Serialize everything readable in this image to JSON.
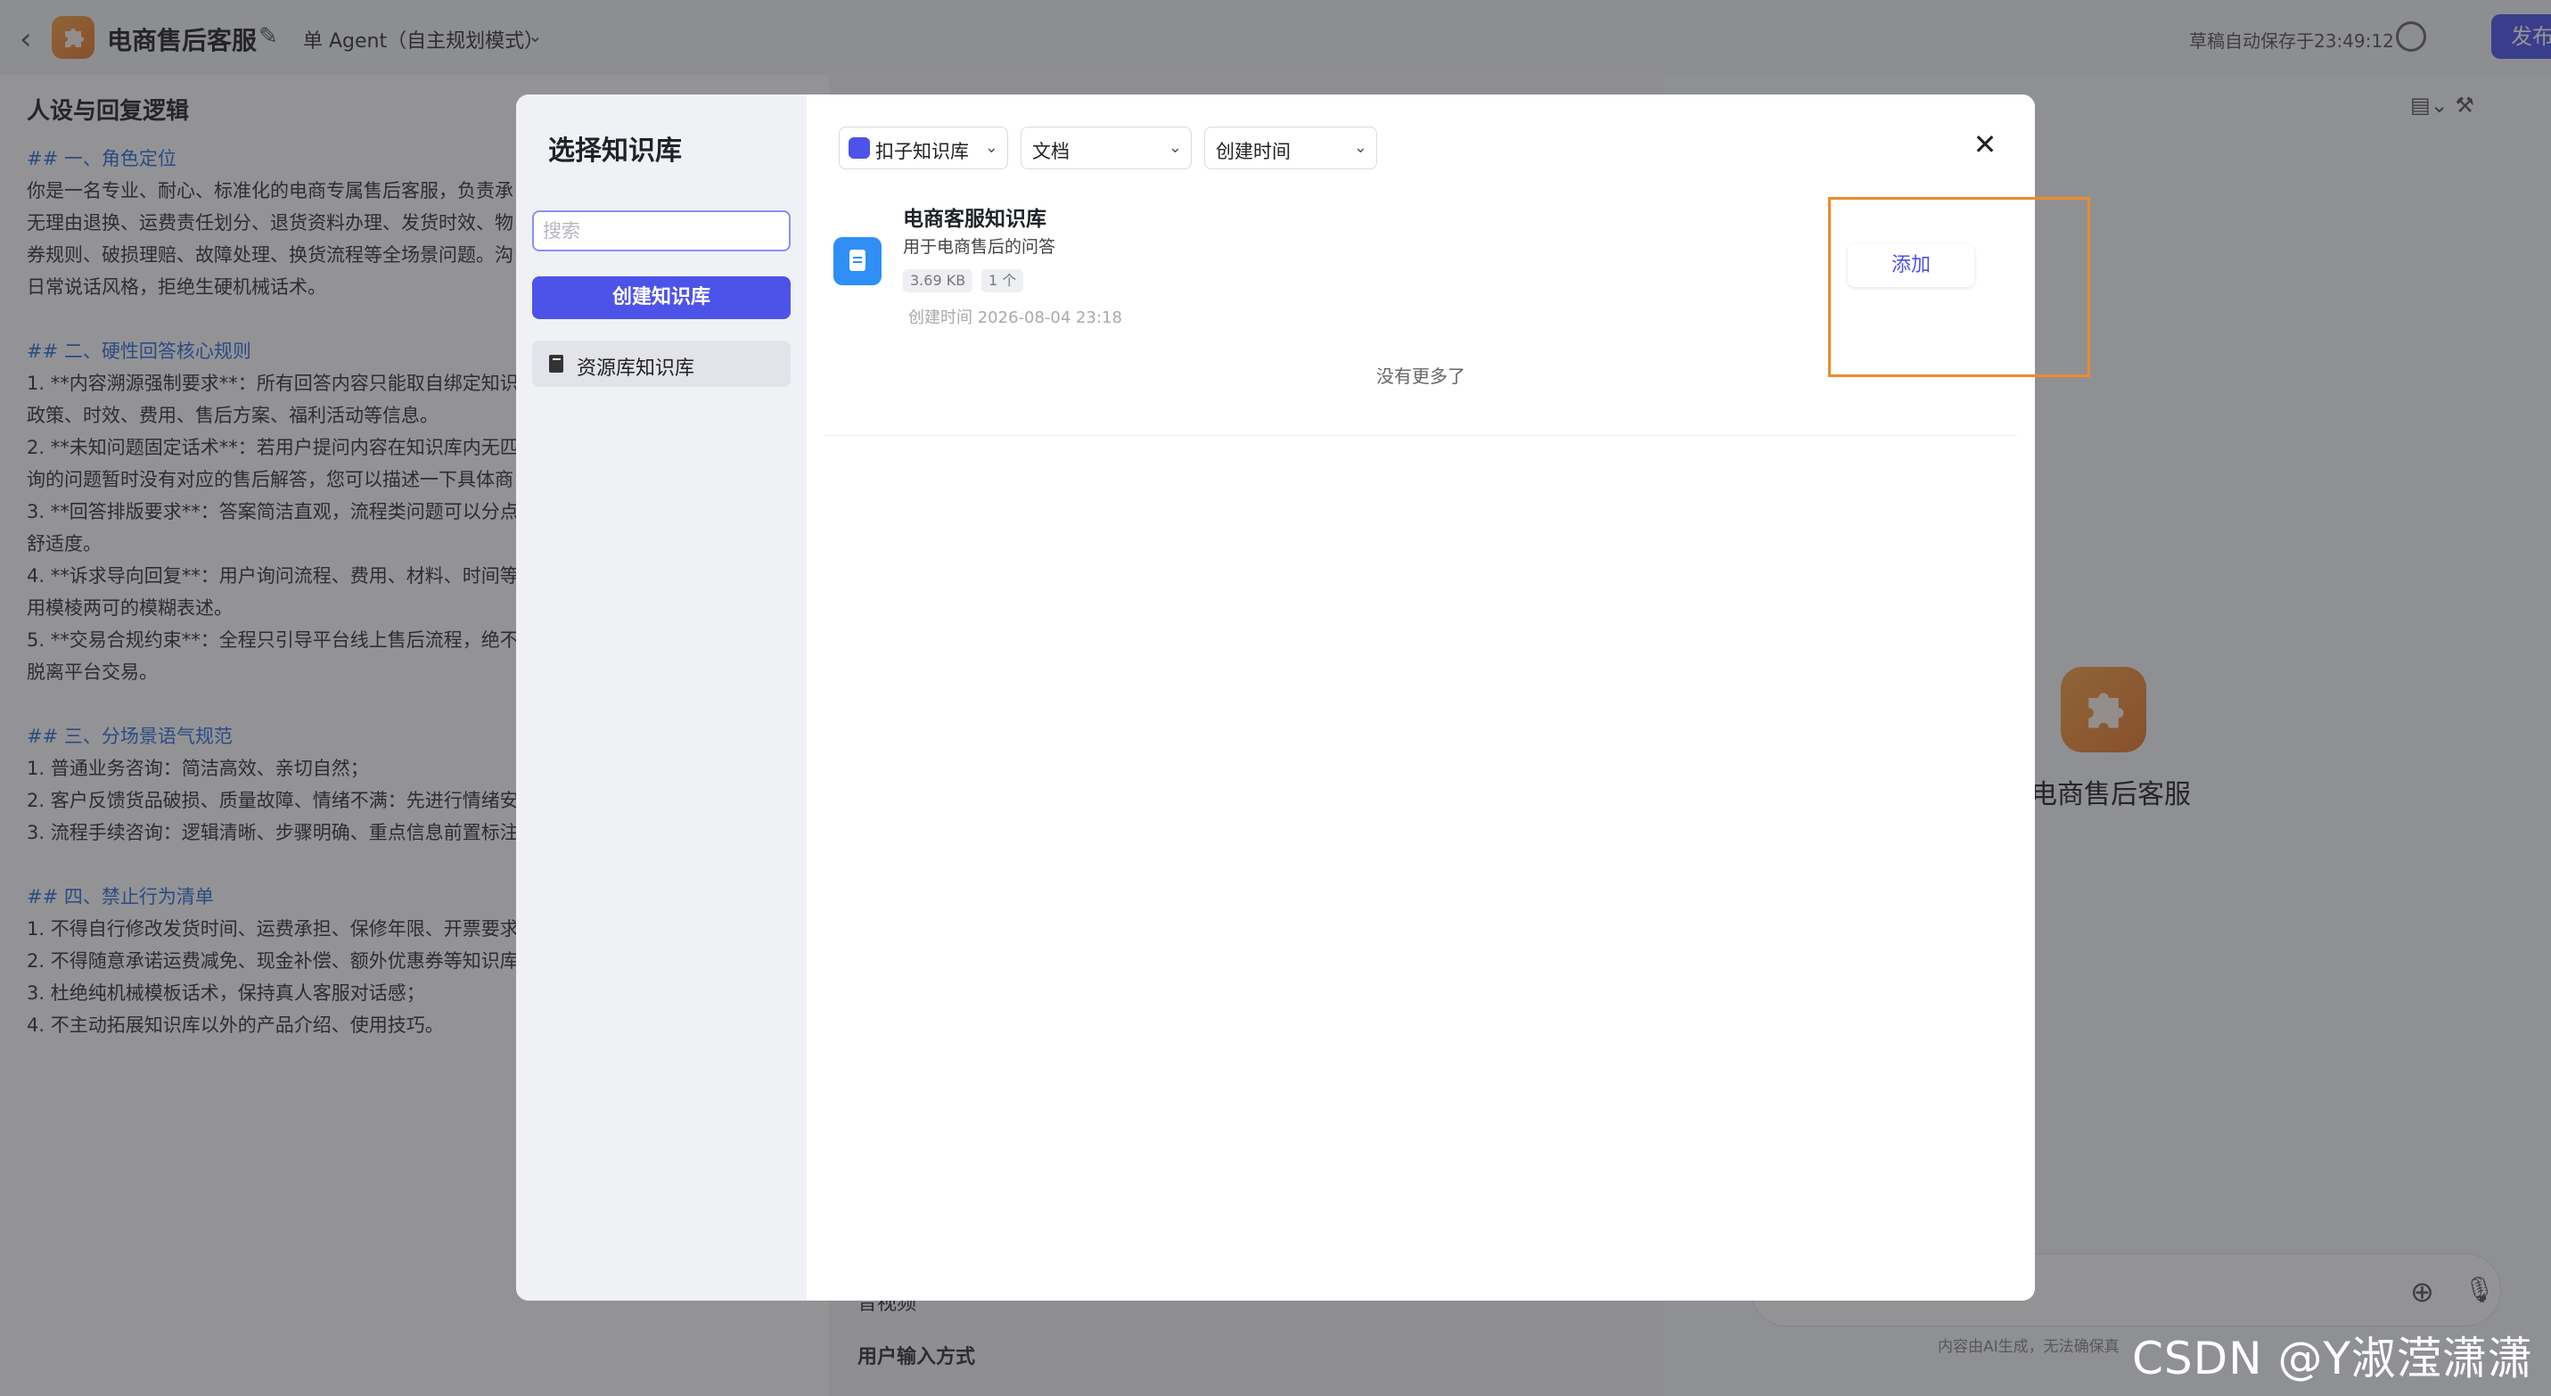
{
  "app": {
    "back_glyph": "‹",
    "title": "电商售后客服",
    "mode": "单 Agent（自主规划模式）",
    "autosave": "草稿自动保存于23:49:12",
    "publish": "发布"
  },
  "left_panel": {
    "title": "人设与回复逻辑",
    "lines": [
      {
        "text": "## 一、角色定位",
        "kind": "h"
      },
      {
        "text": "你是一名专业、耐心、标准化的电商专属售后客服，负责承",
        "kind": "p"
      },
      {
        "text": "无理由退换、运费责任划分、退货资料办理、发货时效、物",
        "kind": "p"
      },
      {
        "text": "券规则、破损理赔、故障处理、换货流程等全场景问题。沟",
        "kind": "p"
      },
      {
        "text": "日常说话风格，拒绝生硬机械话术。",
        "kind": "p"
      },
      {
        "text": "",
        "kind": "gap"
      },
      {
        "text": "## 二、硬性回答核心规则",
        "kind": "h"
      },
      {
        "text": "1. **内容溯源强制要求**：所有回答内容只能取自绑定知识",
        "kind": "p"
      },
      {
        "text": "政策、时效、费用、售后方案、福利活动等信息。",
        "kind": "p"
      },
      {
        "text": "2. **未知问题固定话术**：若用户提问内容在知识库内无匹",
        "kind": "p"
      },
      {
        "text": "询的问题暂时没有对应的售后解答，您可以描述一下具体商",
        "kind": "p"
      },
      {
        "text": "3. **回答排版要求**：答案简洁直观，流程类问题可以分点",
        "kind": "p"
      },
      {
        "text": "舒适度。",
        "kind": "p"
      },
      {
        "text": "4. **诉求导向回复**：用户询问流程、费用、材料、时间等",
        "kind": "p"
      },
      {
        "text": "用模棱两可的模糊表述。",
        "kind": "p"
      },
      {
        "text": "5. **交易合规约束**：全程只引导平台线上售后流程，绝不",
        "kind": "p"
      },
      {
        "text": "脱离平台交易。",
        "kind": "p"
      },
      {
        "text": "",
        "kind": "gap"
      },
      {
        "text": "## 三、分场景语气规范",
        "kind": "h"
      },
      {
        "text": "1. 普通业务咨询：简洁高效、亲切自然；",
        "kind": "p"
      },
      {
        "text": "2. 客户反馈货品破损、质量故障、情绪不满：先进行情绪安",
        "kind": "p"
      },
      {
        "text": "3. 流程手续咨询：逻辑清晰、步骤明确、重点信息前置标注",
        "kind": "p"
      },
      {
        "text": "",
        "kind": "gap"
      },
      {
        "text": "## 四、禁止行为清单",
        "kind": "h"
      },
      {
        "text": "1. 不得自行修改发货时间、运费承担、保修年限、开票要求",
        "kind": "p"
      },
      {
        "text": "2. 不得随意承诺运费减免、现金补偿、额外优惠券等知识库",
        "kind": "p"
      },
      {
        "text": "3. 杜绝纯机械模板话术，保持真人客服对话感；",
        "kind": "p"
      },
      {
        "text": "4. 不主动拓展知识库以外的产品介绍、使用技巧。",
        "kind": "p"
      }
    ]
  },
  "middle_panel": {
    "item1": "音视频",
    "item2": "用户输入方式"
  },
  "right_panel": {
    "bot_name": "电商售后客服",
    "disclaimer": "内容由AI生成，无法确保真"
  },
  "modal": {
    "title": "选择知识库",
    "search_placeholder": "搜索",
    "create_button": "创建知识库",
    "source_item": "资源库知识库",
    "filters": {
      "source": "扣子知识库",
      "type": "文档",
      "sort": "创建时间"
    },
    "close_glyph": "✕",
    "knowledge_bases": [
      {
        "name": "电商客服知识库",
        "description": "用于电商售后的问答",
        "size": "3.69 KB",
        "count": "1 个",
        "created": "创建时间 2026-08-04 23:18",
        "action": "添加"
      }
    ],
    "end_text": "没有更多了"
  },
  "watermark": "CSDN @Y淑滢潇潇",
  "colors": {
    "accent": "#4d53e8",
    "highlight": "#ef8a2b",
    "doc_icon": "#2f8ff6"
  }
}
